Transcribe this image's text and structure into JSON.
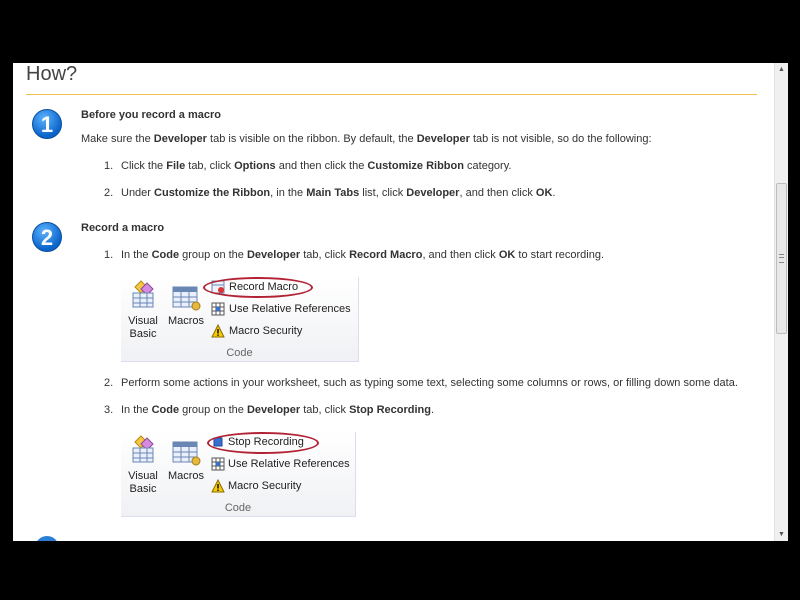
{
  "heading": "How?",
  "steps": [
    {
      "number": "1",
      "title": "Before you record a macro",
      "intro": [
        "Make sure the ",
        "Developer",
        " tab is visible on the ribbon. By default, the ",
        "Developer",
        " tab is not visible, so do the following:"
      ],
      "items": [
        {
          "n": "1.",
          "parts": [
            "Click the ",
            "File",
            " tab, click ",
            "Options",
            " and then click the ",
            "Customize Ribbon",
            " category."
          ]
        },
        {
          "n": "2.",
          "parts": [
            "Under ",
            "Customize the Ribbon",
            ", in the ",
            "Main Tabs",
            " list, click ",
            "Developer",
            ", and then click ",
            "OK",
            "."
          ]
        }
      ]
    },
    {
      "number": "2",
      "title": "Record a macro",
      "items": [
        {
          "n": "1.",
          "parts": [
            "In the ",
            "Code",
            " group on the ",
            "Developer",
            " tab, click ",
            "Record Macro",
            ", and then click ",
            "OK",
            " to start recording."
          ]
        },
        {
          "n": "2.",
          "parts": [
            "Perform some actions in your worksheet, such as typing some text, selecting some columns or rows, or filling down some data."
          ]
        },
        {
          "n": "3.",
          "parts": [
            "In the ",
            "Code",
            " group on the ",
            "Developer",
            " tab, click ",
            "Stop Recording",
            "."
          ]
        }
      ]
    }
  ],
  "ribbon1": {
    "visual_basic": "Visual Basic",
    "macros": "Macros",
    "item1": "Record Macro",
    "item2": "Use Relative References",
    "item3": "Macro Security",
    "group": "Code"
  },
  "ribbon2": {
    "visual_basic": "Visual Basic",
    "macros": "Macros",
    "item1": "Stop Recording",
    "item2": "Use Relative References",
    "item3": "Macro Security",
    "group": "Code"
  },
  "colors": {
    "accent_rule": "#f1c24f",
    "step_blue": "#0a63c9",
    "highlight_oval": "#b22234"
  }
}
